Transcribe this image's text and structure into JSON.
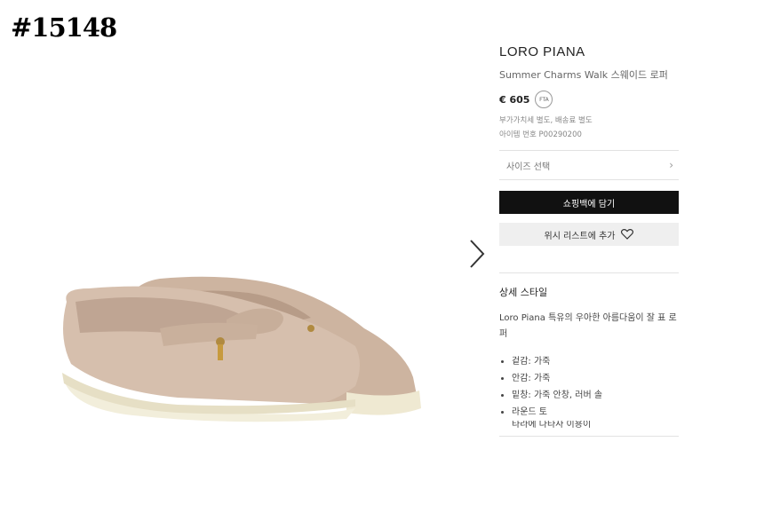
{
  "watermark": "#15148",
  "product": {
    "brand": "LORO PIANA",
    "name": "Summer Charms Walk 스웨이드 로퍼",
    "price": "€ 605",
    "badge": "FTA",
    "tax_note": "부가가치세 별도, 배송료 별도",
    "item_number": "아이템 번호 P00290200"
  },
  "actions": {
    "size_select": "사이즈 선택",
    "add_to_bag": "쇼핑백에 담기",
    "wishlist": "위시 리스트에 추가"
  },
  "details": {
    "title": "상세 스타일",
    "description": "Loro Piana 특유의 우아한 아름다움이 잘 표 로퍼",
    "bullets": [
      "겉감: 가죽",
      "안감: 가죽",
      "밑창: 가죽 안창, 러버 솔",
      "라운드 토",
      "타라에 나타사 이용이"
    ]
  },
  "icons": {
    "next": "chevron-right-icon",
    "size_chevron": "chevron-right-icon",
    "wishlist": "heart-icon"
  },
  "colors": {
    "suede": "#d6bfad",
    "sole": "#f2eedb",
    "button_dark": "#111111",
    "button_light": "#efefef"
  }
}
